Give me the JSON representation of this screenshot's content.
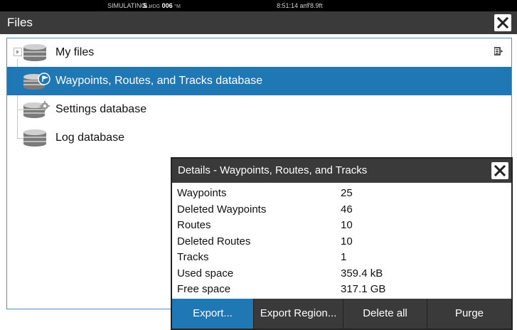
{
  "status_bar": {
    "simulating": "SIMULATING...",
    "hdg_prefix": "S",
    "hdg_label": "HDG",
    "hdg_value": "006",
    "hdg_unit": "°M",
    "time": "8:51:14 am",
    "depth": "78.9ft"
  },
  "window": {
    "title": "Files",
    "close_icon": "close-icon"
  },
  "file_tree": {
    "items": [
      {
        "label": "My files",
        "icon": "database-icon",
        "selected": false,
        "expandable": true
      },
      {
        "label": "Waypoints, Routes, and Tracks database",
        "icon": "database-waypoint-icon",
        "selected": true
      },
      {
        "label": "Settings database",
        "icon": "database-settings-icon",
        "selected": false
      },
      {
        "label": "Log database",
        "icon": "database-icon",
        "selected": false
      }
    ],
    "menu_icon": "context-menu-icon"
  },
  "details_dialog": {
    "title": "Details - Waypoints, Routes, and Tracks",
    "rows": [
      {
        "key": "Waypoints",
        "value": "25"
      },
      {
        "key": "Deleted Waypoints",
        "value": "46"
      },
      {
        "key": "Routes",
        "value": "10"
      },
      {
        "key": "Deleted Routes",
        "value": "10"
      },
      {
        "key": "Tracks",
        "value": "1"
      },
      {
        "key": "Used space",
        "value": "359.4 kB"
      },
      {
        "key": "Free space",
        "value": "317.1 GB"
      }
    ],
    "buttons": [
      {
        "label": "Export...",
        "active": true
      },
      {
        "label": "Export Region...",
        "active": false
      },
      {
        "label": "Delete all",
        "active": false
      },
      {
        "label": "Purge",
        "active": false
      }
    ]
  },
  "colors": {
    "accent": "#1f77b4",
    "title_bar": "#3a3a3a",
    "status_bar": "#000000"
  }
}
